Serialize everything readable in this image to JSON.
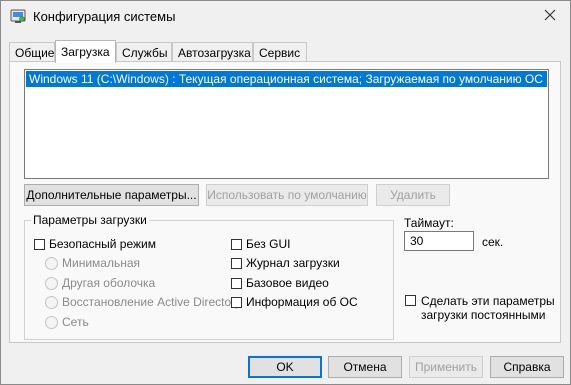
{
  "window": {
    "title": "Конфигурация системы"
  },
  "tabs": [
    {
      "label": "Общие",
      "active": false
    },
    {
      "label": "Загрузка",
      "active": true
    },
    {
      "label": "Службы",
      "active": false
    },
    {
      "label": "Автозагрузка",
      "active": false
    },
    {
      "label": "Сервис",
      "active": false
    }
  ],
  "os_list": {
    "entries": [
      "Windows 11 (C:\\Windows) : Текущая операционная система; Загружаемая по умолчанию ОС"
    ]
  },
  "list_buttons": {
    "advanced": "Дополнительные параметры...",
    "set_default": "Использовать по умолчанию",
    "delete": "Удалить"
  },
  "boot_options": {
    "legend": "Параметры загрузки",
    "safe_boot": "Безопасный режим",
    "minimal": "Минимальная",
    "alternate_shell": "Другая оболочка",
    "ad_repair": "Восстановление Active Directory",
    "network": "Сеть",
    "no_gui": "Без GUI",
    "boot_log": "Журнал загрузки",
    "base_video": "Базовое видео",
    "os_info": "Информация  об ОС"
  },
  "timeout": {
    "label": "Таймаут:",
    "value": "30",
    "unit": "сек."
  },
  "persist": {
    "label": "Сделать эти параметры загрузки постоянными"
  },
  "footer": {
    "ok": "OK",
    "cancel": "Отмена",
    "apply": "Применить",
    "help": "Справка"
  },
  "icons": {
    "app": "msconfig-app-icon",
    "close": "close-icon"
  }
}
